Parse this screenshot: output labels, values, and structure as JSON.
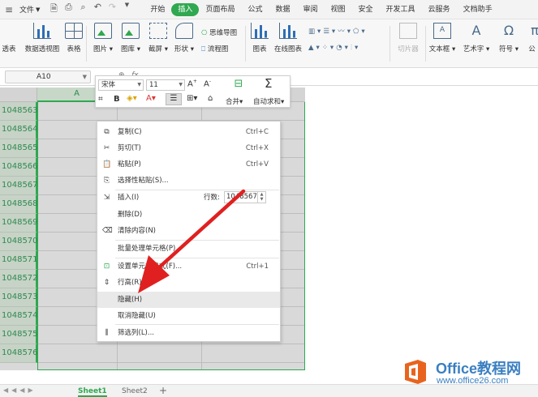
{
  "menubar": {
    "file_label": "文件",
    "tabs": [
      {
        "label": "开始"
      },
      {
        "label": "插入"
      },
      {
        "label": "页面布局"
      },
      {
        "label": "公式"
      },
      {
        "label": "数据"
      },
      {
        "label": "审阅"
      },
      {
        "label": "视图"
      },
      {
        "label": "安全"
      },
      {
        "label": "开发工具"
      },
      {
        "label": "云服务"
      },
      {
        "label": "文档助手"
      }
    ],
    "active_tab": "插入",
    "accent_color": "#2fa84f"
  },
  "ribbon": {
    "pivot_table_partial": "透表",
    "pivot_chart": "数据透视图",
    "table": "表格",
    "picture": "图片",
    "gallery": "图库",
    "screenshot": "截屏",
    "shape": "形状",
    "mindmap": "思维导图",
    "flowchart": "流程图",
    "chart": "图表",
    "online_chart": "在线图表",
    "slicer": "切片器",
    "textbox": "文本框",
    "wordart": "艺术字",
    "symbol": "符号",
    "formula_partial": "公"
  },
  "formula_bar": {
    "name_box": "A10",
    "fx_label": "fx"
  },
  "sheet": {
    "column_header": "A",
    "rows": [
      "1048563",
      "1048564",
      "1048565",
      "1048566",
      "1048567",
      "1048568",
      "1048569",
      "1048570",
      "1048571",
      "1048572",
      "1048573",
      "1048574",
      "1048575",
      "1048576"
    ]
  },
  "mini_toolbar": {
    "font": "宋体",
    "size": "11",
    "bold": "B",
    "merge": "合并",
    "autosum": "自动求和"
  },
  "context_menu": {
    "copy": {
      "label": "复制(C)",
      "shortcut": "Ctrl+C"
    },
    "cut": {
      "label": "剪切(T)",
      "shortcut": "Ctrl+X"
    },
    "paste": {
      "label": "粘贴(P)",
      "shortcut": "Ctrl+V"
    },
    "paste_special": {
      "label": "选择性粘贴(S)..."
    },
    "insert": {
      "label": "插入(I)",
      "row_count_label": "行数:",
      "row_count_value": "1048567"
    },
    "delete": {
      "label": "删除(D)"
    },
    "clear": {
      "label": "清除内容(N)"
    },
    "batch": {
      "label": "批量处理单元格(P)"
    },
    "format_cells": {
      "label": "设置单元格格式(F)...",
      "shortcut": "Ctrl+1"
    },
    "row_height": {
      "label": "行高(R)..."
    },
    "hide": {
      "label": "隐藏(H)"
    },
    "unhide": {
      "label": "取消隐藏(U)"
    },
    "filter_col": {
      "label": "筛选列(L)..."
    }
  },
  "sheet_tabs": {
    "sheet1": "Sheet1",
    "sheet2": "Sheet2",
    "add": "+"
  },
  "watermark": {
    "brand": "Office教程网",
    "url": "www.office26.com"
  },
  "colors": {
    "accent_green": "#2fa84f",
    "arrow_red": "#e02020",
    "watermark_orange": "#e8641e",
    "watermark_blue": "#3a7fc1"
  }
}
